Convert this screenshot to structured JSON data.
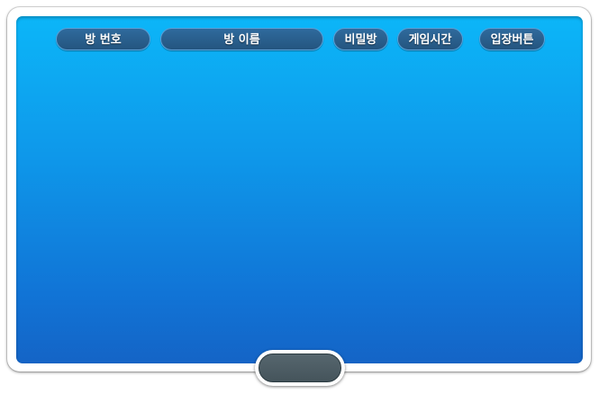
{
  "room_list": {
    "headers": {
      "room_number": "방 번호",
      "room_name": "방 이름",
      "secret_room": "비밀방",
      "game_time": "게임시간",
      "enter_button": "입장버튼"
    },
    "rows": []
  },
  "bottom_button": {
    "label": ""
  },
  "colors": {
    "panel_top": "#0cb6f8",
    "panel_bottom": "#1464c6",
    "header_pill": "#2a5f8e",
    "bottom_button": "#4e5d64"
  }
}
